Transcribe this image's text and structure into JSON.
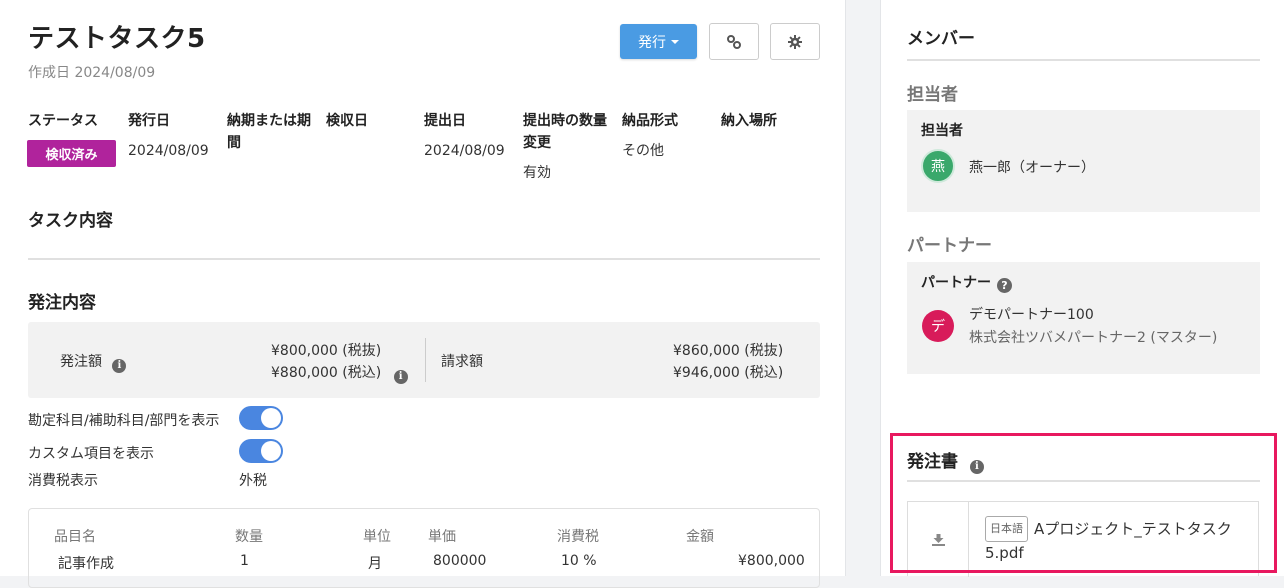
{
  "task": {
    "title": "テストタスク5",
    "created": "作成日 2024/08/09"
  },
  "toolbar": {
    "issue_label": "発行"
  },
  "info": {
    "headers": [
      "ステータス",
      "発行日",
      "納期または期間",
      "検収日",
      "提出日",
      "提出時の数量変更",
      "納品形式",
      "納入場所"
    ],
    "status_badge": "検収済み",
    "issue_date": "2024/08/09",
    "submit_date": "2024/08/09",
    "qty_change": "有効",
    "delivery_format": "その他"
  },
  "sections": {
    "task_content": "タスク内容",
    "order_content": "発注内容"
  },
  "order": {
    "amount_label": "発注額",
    "amount_ex": "¥800,000 (税抜)",
    "amount_in": "¥880,000 (税込)",
    "invoice_label": "請求額",
    "invoice_ex": "¥860,000 (税抜)",
    "invoice_in": "¥946,000 (税込)"
  },
  "toggles": {
    "accounts_label": "勘定科目/補助科目/部門を表示",
    "accounts_on": true,
    "custom_label": "カスタム項目を表示",
    "custom_on": true,
    "tax_label": "消費税表示",
    "tax_value": "外税"
  },
  "items": {
    "headers": [
      "品目名",
      "数量",
      "単位",
      "単価",
      "消費税",
      "金額"
    ],
    "rows": [
      [
        "記事作成",
        "1",
        "月",
        "800000",
        "10 %",
        "¥800,000"
      ]
    ]
  },
  "sidebar": {
    "members_title": "メンバー",
    "assignee_section": "担当者",
    "assignee_label": "担当者",
    "assignee_avatar": "燕",
    "assignee_name": "燕一郎（オーナー）",
    "partner_section": "パートナー",
    "partner_label": "パートナー",
    "partner_avatar": "デ",
    "partner_name": "デモパートナー100",
    "partner_company": "株式会社ツバメパートナー2 (マスター)",
    "po_title": "発注書",
    "po_lang": "日本語",
    "po_filename": "Aプロジェクト_テストタスク5.pdf"
  },
  "colors": {
    "primary": "#4a9be3",
    "badge": "#b0239c",
    "toggle": "#4a86e0",
    "assignee_avatar": "#3aa86b",
    "partner_avatar": "#d81b5a",
    "highlight": "#e8185f"
  }
}
